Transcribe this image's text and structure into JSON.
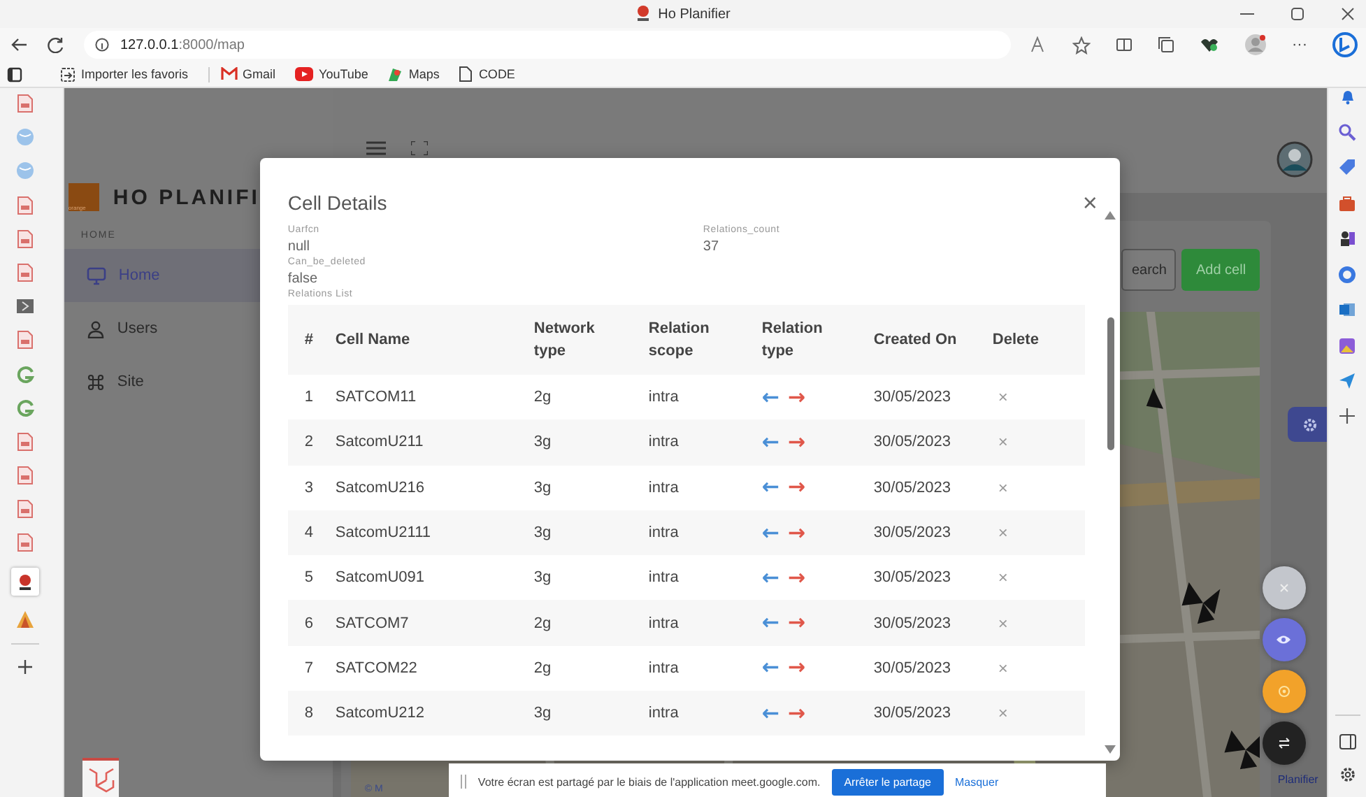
{
  "browser": {
    "title": "Ho Planifier",
    "url_host": "127.0.0.1",
    "url_path": ":8000/map",
    "more": "···",
    "bookmarks": [
      {
        "label": "Importer les favoris",
        "kind": "import"
      },
      {
        "label": "Gmail",
        "kind": "mail"
      },
      {
        "label": "YouTube",
        "kind": "video"
      },
      {
        "label": "Maps",
        "kind": "map"
      },
      {
        "label": "CODE",
        "kind": "page"
      }
    ]
  },
  "app": {
    "logo_text": "orange",
    "brand": "HO PLANIFI",
    "sidebar": {
      "section": "HOME",
      "items": [
        {
          "label": "Home",
          "kind": "monitor",
          "selected": true
        },
        {
          "label": "Users",
          "kind": "user",
          "selected": false
        },
        {
          "label": "Site",
          "kind": "command",
          "selected": false
        }
      ]
    },
    "toolbar": {
      "search_button": "earch",
      "add_button": "Add cell"
    },
    "map_attribution": "© M",
    "footer_text": "Planifier"
  },
  "modal": {
    "title": "Cell Details",
    "close": "×",
    "fields": [
      {
        "label": "Uarfcn",
        "value": "null"
      },
      {
        "label": "Relations_count",
        "value": "37"
      },
      {
        "label": "Can_be_deleted",
        "value": "false"
      }
    ],
    "list_label": "Relations List",
    "columns": [
      "#",
      "Cell Name",
      "Network type",
      "Relation scope",
      "Relation type",
      "Created On",
      "Delete"
    ],
    "rows": [
      {
        "n": "1",
        "cell_name": "SATCOM11",
        "network_type": "2g",
        "scope": "intra",
        "relation_type": [
          {
            "glyph": "←",
            "color": "#4a8fd6"
          },
          {
            "glyph": "→",
            "color": "#e0574a"
          }
        ],
        "created_on": "30/05/2023",
        "delete": "×"
      },
      {
        "n": "2",
        "cell_name": "SatcomU211",
        "network_type": "3g",
        "scope": "intra",
        "relation_type": [
          {
            "glyph": "←",
            "color": "#4a8fd6"
          },
          {
            "glyph": "→",
            "color": "#e0574a"
          }
        ],
        "created_on": "30/05/2023",
        "delete": "×"
      },
      {
        "n": "3",
        "cell_name": "SatcomU216",
        "network_type": "3g",
        "scope": "intra",
        "relation_type": [
          {
            "glyph": "←",
            "color": "#4a8fd6"
          },
          {
            "glyph": "→",
            "color": "#e0574a"
          }
        ],
        "created_on": "30/05/2023",
        "delete": "×"
      },
      {
        "n": "4",
        "cell_name": "SatcomU2111",
        "network_type": "3g",
        "scope": "intra",
        "relation_type": [
          {
            "glyph": "←",
            "color": "#4a8fd6"
          },
          {
            "glyph": "→",
            "color": "#e0574a"
          }
        ],
        "created_on": "30/05/2023",
        "delete": "×"
      },
      {
        "n": "5",
        "cell_name": "SatcomU091",
        "network_type": "3g",
        "scope": "intra",
        "relation_type": [
          {
            "glyph": "←",
            "color": "#4a8fd6"
          },
          {
            "glyph": "→",
            "color": "#e0574a"
          }
        ],
        "created_on": "30/05/2023",
        "delete": "×"
      },
      {
        "n": "6",
        "cell_name": "SATCOM7",
        "network_type": "2g",
        "scope": "intra",
        "relation_type": [
          {
            "glyph": "←",
            "color": "#4a8fd6"
          },
          {
            "glyph": "→",
            "color": "#e0574a"
          }
        ],
        "created_on": "30/05/2023",
        "delete": "×"
      },
      {
        "n": "7",
        "cell_name": "SATCOM22",
        "network_type": "2g",
        "scope": "intra",
        "relation_type": [
          {
            "glyph": "←",
            "color": "#4a8fd6"
          },
          {
            "glyph": "→",
            "color": "#e0574a"
          }
        ],
        "created_on": "30/05/2023",
        "delete": "×"
      },
      {
        "n": "8",
        "cell_name": "SatcomU212",
        "network_type": "3g",
        "scope": "intra",
        "relation_type": [
          {
            "glyph": "←",
            "color": "#4a8fd6"
          },
          {
            "glyph": "→",
            "color": "#e0574a"
          }
        ],
        "created_on": "30/05/2023",
        "delete": "×"
      }
    ]
  },
  "share_bar": {
    "message": "Votre écran est partagé par le biais de l'application meet.google.com.",
    "stop_button": "Arrêter le partage",
    "hide_link": "Masquer"
  }
}
